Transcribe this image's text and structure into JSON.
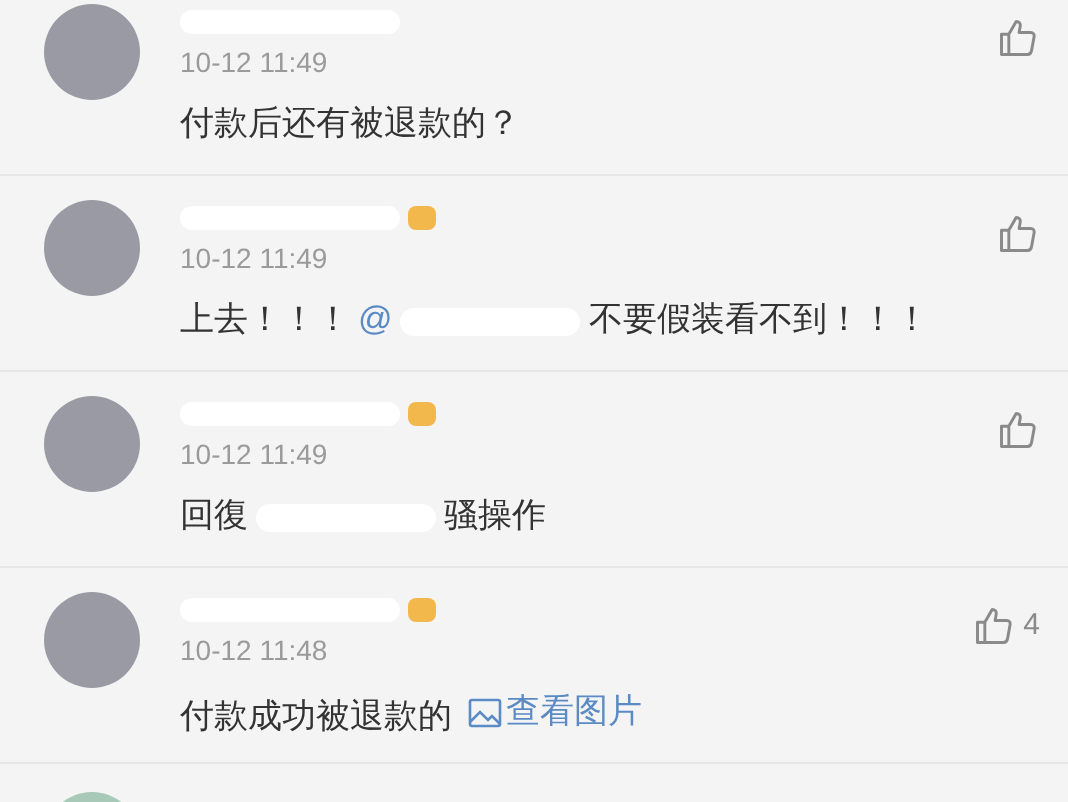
{
  "comments": [
    {
      "badge": false,
      "time": "10-12 11:49",
      "content": [
        {
          "kind": "text",
          "text": "付款后还有被退款的？"
        }
      ]
    },
    {
      "badge": true,
      "time": "10-12 11:49",
      "content": [
        {
          "kind": "text",
          "text": "上去！！！"
        },
        {
          "kind": "mention",
          "text": "@"
        },
        {
          "kind": "redacted"
        },
        {
          "kind": "text",
          "text": "不要假装看不到！！！"
        }
      ]
    },
    {
      "badge": true,
      "time": "10-12 11:49",
      "content": [
        {
          "kind": "text",
          "text": "回復"
        },
        {
          "kind": "redacted"
        },
        {
          "kind": "text",
          "text": "骚操作"
        }
      ]
    },
    {
      "badge": true,
      "time": "10-12 11:48",
      "likes": "4",
      "content": [
        {
          "kind": "text",
          "text": "付款成功被退款的"
        },
        {
          "kind": "image_link",
          "text": "查看图片"
        }
      ]
    }
  ]
}
